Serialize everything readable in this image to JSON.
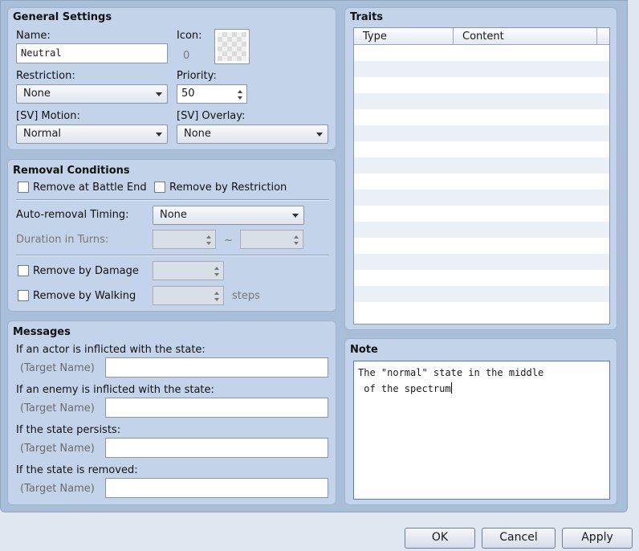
{
  "general": {
    "title": "General Settings",
    "name_label": "Name:",
    "name_value": "Neutral",
    "icon_label": "Icon:",
    "icon_index": "0",
    "restriction_label": "Restriction:",
    "restriction_value": "None",
    "priority_label": "Priority:",
    "priority_value": "50",
    "motion_label": "[SV] Motion:",
    "motion_value": "Normal",
    "overlay_label": "[SV] Overlay:",
    "overlay_value": "None"
  },
  "removal": {
    "title": "Removal Conditions",
    "battle_end_label": "Remove at Battle End",
    "restriction_label": "Remove by Restriction",
    "timing_label": "Auto-removal Timing:",
    "timing_value": "None",
    "duration_label": "Duration in Turns:",
    "duration_sep": "~",
    "damage_label": "Remove by Damage",
    "walking_label": "Remove by Walking",
    "steps_label": "steps"
  },
  "messages": {
    "title": "Messages",
    "target_placeholder": "(Target Name)",
    "items": [
      {
        "label": "If an actor is inflicted with the state:",
        "value": ""
      },
      {
        "label": "If an enemy is inflicted with the state:",
        "value": ""
      },
      {
        "label": "If the state persists:",
        "value": ""
      },
      {
        "label": "If the state is removed:",
        "value": ""
      }
    ]
  },
  "traits": {
    "title": "Traits",
    "columns": [
      "Type",
      "Content"
    ],
    "rows": []
  },
  "note": {
    "title": "Note",
    "lines": [
      "The \"normal\" state in the middle",
      " of the spectrum"
    ]
  },
  "buttons": {
    "ok": "OK",
    "cancel": "Cancel",
    "apply": "Apply"
  }
}
